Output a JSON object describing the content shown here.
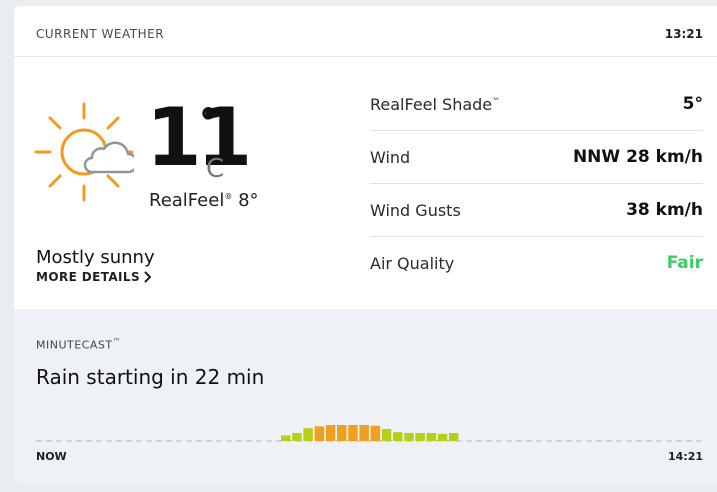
{
  "header": {
    "title": "CURRENT WEATHER",
    "time": "13:21"
  },
  "current": {
    "icon": "sun-behind-cloud-icon",
    "temperature": "11",
    "degree_symbol": "°",
    "unit": "C",
    "realfeel_label": "RealFeel",
    "realfeel_mark": "®",
    "realfeel_value": "8°",
    "phrase": "Mostly sunny",
    "more_details": "MORE DETAILS"
  },
  "details": [
    {
      "label": "RealFeel Shade",
      "label_mark": "™",
      "value": "5°"
    },
    {
      "label": "Wind",
      "value": "NNW 28 km/h"
    },
    {
      "label": "Wind Gusts",
      "value": "38 km/h"
    },
    {
      "label": "Air Quality",
      "value": "Fair"
    }
  ],
  "minutecast": {
    "title": "MINUTECAST",
    "title_mark": "™",
    "phrase": "Rain starting in 22 min",
    "start_label": "NOW",
    "end_label": "14:21",
    "bars": [
      0.35,
      0.5,
      0.8,
      0.92,
      1.0,
      1.0,
      1.0,
      1.0,
      0.95,
      0.75,
      0.55,
      0.5,
      0.5,
      0.5,
      0.45,
      0.5
    ]
  },
  "colors": {
    "air_quality_fair": "#3dcb64",
    "sun": "#f39a1e",
    "cloud": "#8f969e",
    "bar_light": "#b7cf18",
    "bar_heavy": "#f0a020",
    "baseline": "#c9ccd1"
  }
}
